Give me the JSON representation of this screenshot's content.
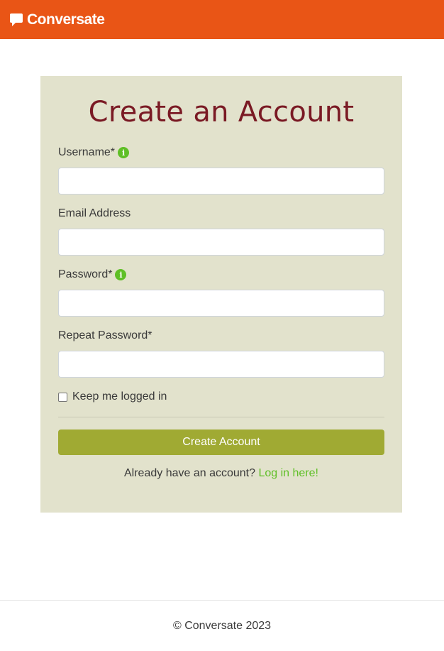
{
  "colors": {
    "header_bg": "#e95516",
    "card_bg": "#e2e2cc",
    "title_color": "#7a1a24",
    "button_bg": "#a0aa33",
    "link_color": "#5fbf26",
    "info_icon_color": "#5fbf26"
  },
  "header": {
    "brand_icon": "speech-bubble-icon",
    "brand_name": "Conversate"
  },
  "form": {
    "title": "Create an Account",
    "fields": [
      {
        "label": "Username*",
        "value": "",
        "has_info_icon": true
      },
      {
        "label": "Email Address",
        "value": "",
        "has_info_icon": false
      },
      {
        "label": "Password*",
        "value": "",
        "has_info_icon": true
      },
      {
        "label": "Repeat Password*",
        "value": "",
        "has_info_icon": false
      }
    ],
    "remember_label": "Keep me logged in",
    "remember_checked": false,
    "submit_label": "Create Account",
    "login_prompt": "Already have an account?",
    "login_link": "Log in here!"
  },
  "footer": {
    "copyright": "© Conversate 2023"
  }
}
